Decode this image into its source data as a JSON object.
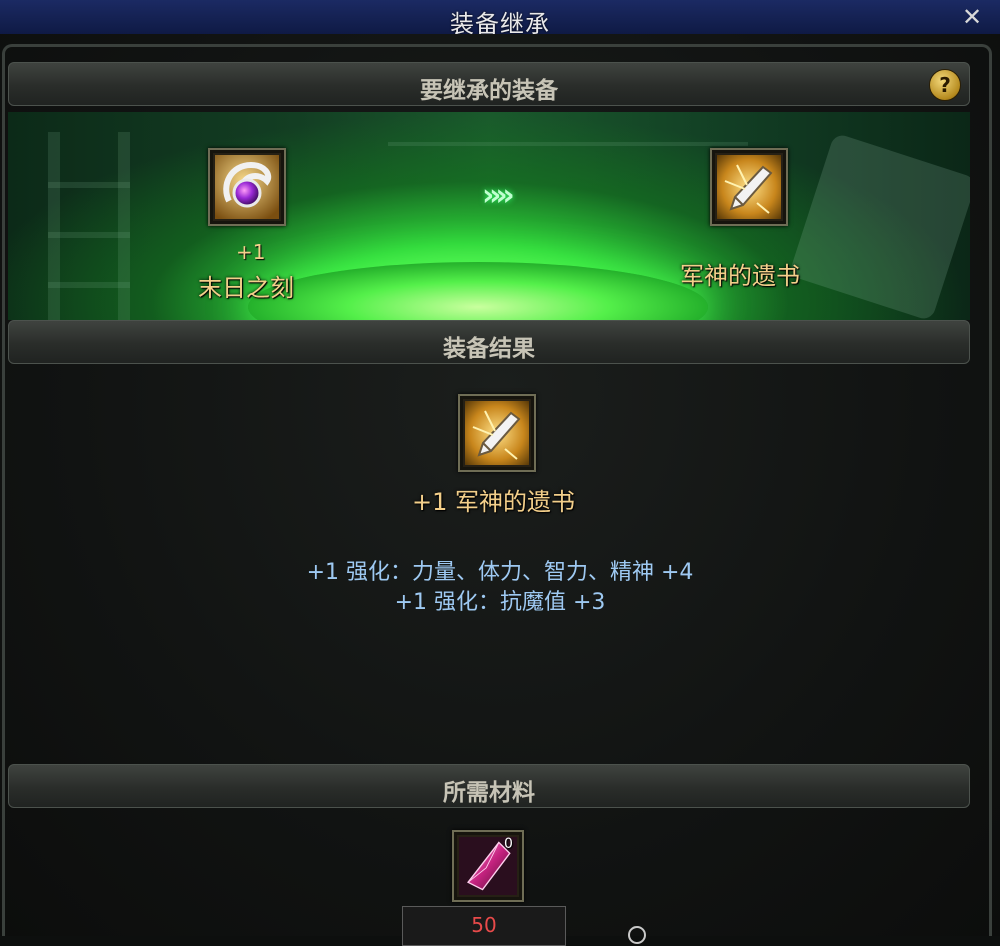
{
  "window": {
    "title": "装备继承",
    "close_glyph": "✕"
  },
  "inherit_section": {
    "title": "要继承的装备",
    "help_glyph": "?",
    "source_item": {
      "enhance": "+1",
      "name": "末日之刻",
      "icon": "purple-gem-orb-icon"
    },
    "arrow_glyph": "»»",
    "target_item": {
      "name": "军神的遗书",
      "icon": "golden-quill-icon"
    }
  },
  "result_section": {
    "title": "装备结果",
    "item_name": "+1 军神的遗书",
    "stats": [
      "+1 强化：力量、体力、智力、精神 +4",
      "+1 强化：抗魔值 +3"
    ]
  },
  "materials_section": {
    "title": "所需材料",
    "material": {
      "icon": "pink-crystal-icon",
      "owned": "0",
      "required": "50"
    }
  },
  "colors": {
    "accent_green": "#3ee04a",
    "item_text": "#f3cf8a",
    "stat_text": "#9ec9f2",
    "required_red": "#e84a4a"
  }
}
